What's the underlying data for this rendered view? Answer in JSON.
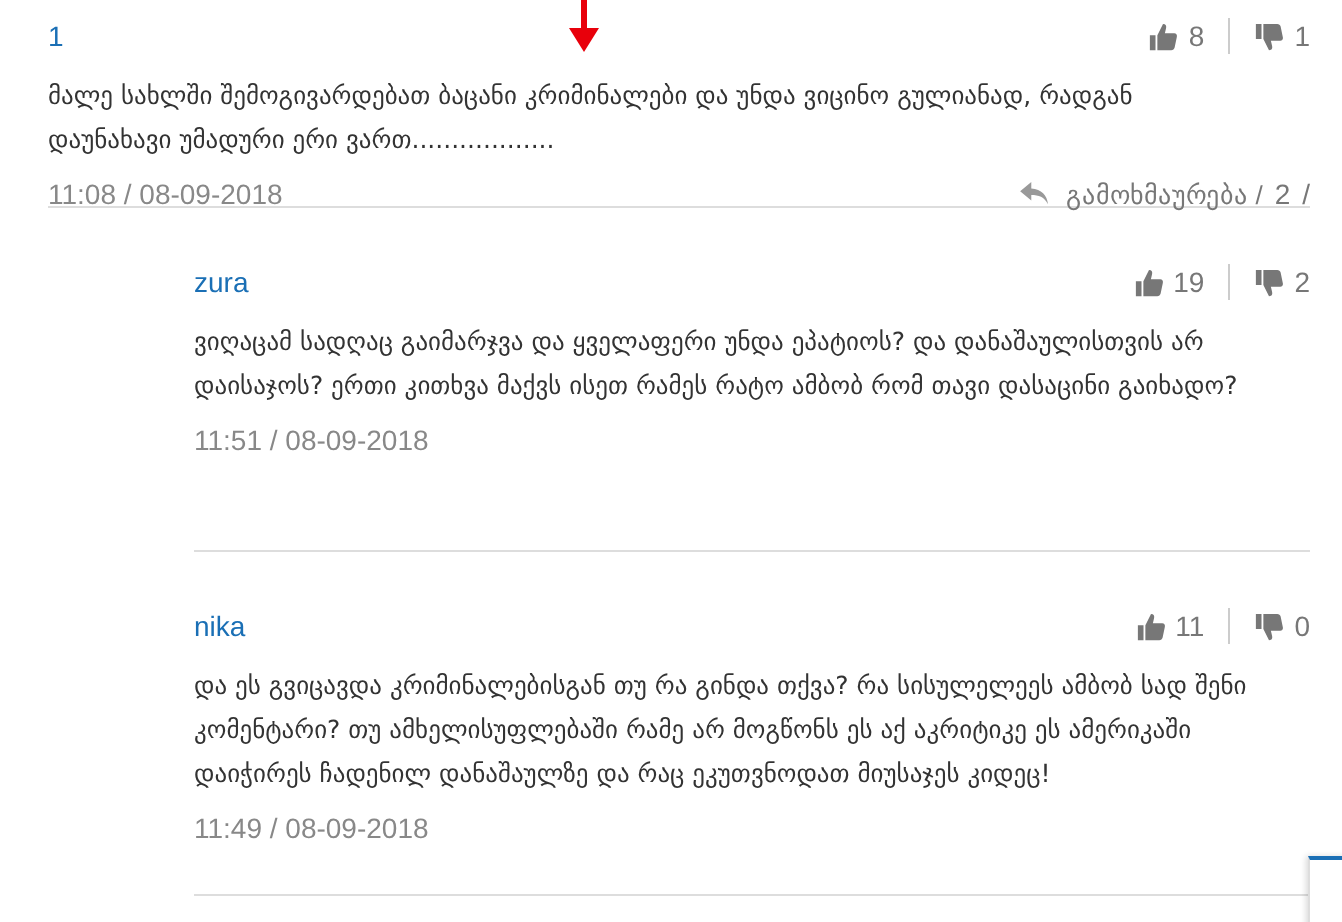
{
  "comments": [
    {
      "author": "1",
      "likes": "8",
      "dislikes": "1",
      "text": "მალე სახლში შემოგივარდებათ ბაცანი კრიმინალები და უნდა ვიცინო გულიანად, რადგან დაუნახავი უმადური ერი ვართ..................",
      "time": "11:08 / 08-09-2018",
      "reply_label": "გამოხმაურება /",
      "reply_count": "2",
      "reply_sep": "/",
      "replies": [
        {
          "author": "zura",
          "likes": "19",
          "dislikes": "2",
          "text": "ვიღაცამ სადღაც გაიმარჯვა და ყველაფერი უნდა ეპატიოს? და დანაშაულისთვის არ დაისაჯოს? ერთი კითხვა მაქვს ისეთ რამეს რატო ამბობ რომ თავი დასაცინი გაიხადო?",
          "time": "11:51 / 08-09-2018"
        },
        {
          "author": "nika",
          "likes": "11",
          "dislikes": "0",
          "text": "და ეს გვიცავდა კრიმინალებისგან თუ რა გინდა თქვა? რა სისულელეეს ამბობ სად შენი კომენტარი? თუ ამხელისუფლებაში რამე არ მოგწონს ეს აქ აკრიტიკე ეს ამერიკაში დაიჭირეს ჩადენილ დანაშაულზე და რაც ეკუთვნოდათ მიუსაჯეს კიდეც!",
          "time": "11:49 / 08-09-2018"
        }
      ]
    }
  ]
}
